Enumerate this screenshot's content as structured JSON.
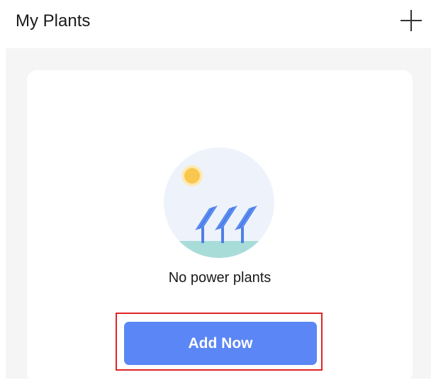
{
  "header": {
    "title": "My Plants",
    "add_icon": "plus-icon"
  },
  "empty_state": {
    "illustration_icon": "solar-panels-illustration-icon",
    "message": "No power plants",
    "action_label": "Add Now"
  },
  "colors": {
    "accent": "#5b86f5",
    "highlight": "#e02424",
    "background": "#f5f5f5",
    "card": "#ffffff",
    "sun": "#f9c74f",
    "panel": "#4f7fe6",
    "ground": "#a8dcd9",
    "illustration_bg": "#eef3fb"
  }
}
